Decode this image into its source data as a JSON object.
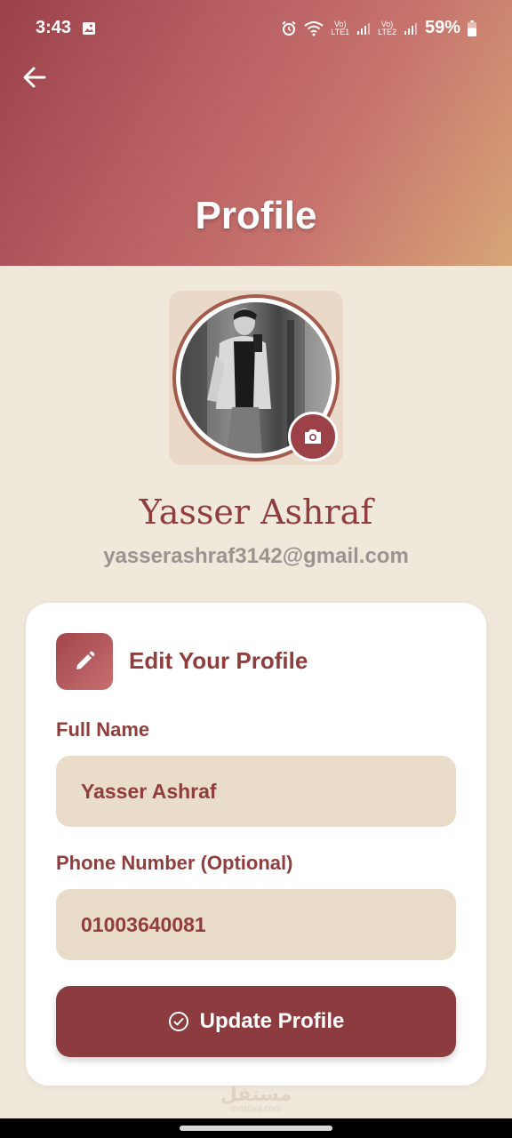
{
  "status_bar": {
    "time": "3:43",
    "battery": "59%",
    "network1": "LTE1",
    "network2": "LTE2"
  },
  "header": {
    "title": "Profile",
    "back_icon": "arrow-left-icon"
  },
  "profile": {
    "name": "Yasser Ashraf",
    "email": "yasserashraf3142@gmail.com",
    "camera_icon": "camera-icon"
  },
  "edit_card": {
    "title": "Edit Your Profile",
    "icon": "pencil-icon",
    "full_name_label": "Full Name",
    "full_name_value": "Yasser Ashraf",
    "phone_label": "Phone Number (Optional)",
    "phone_value": "01003640081",
    "update_label": "Update Profile",
    "update_icon": "check-circle-icon"
  },
  "watermark": {
    "text": "مستقل",
    "sub": "mostaql.com"
  },
  "colors": {
    "accent": "#8f3d3d",
    "button": "#8c3b3f",
    "input_bg": "#e9dcc8",
    "page_bg": "#f1e8dc"
  }
}
